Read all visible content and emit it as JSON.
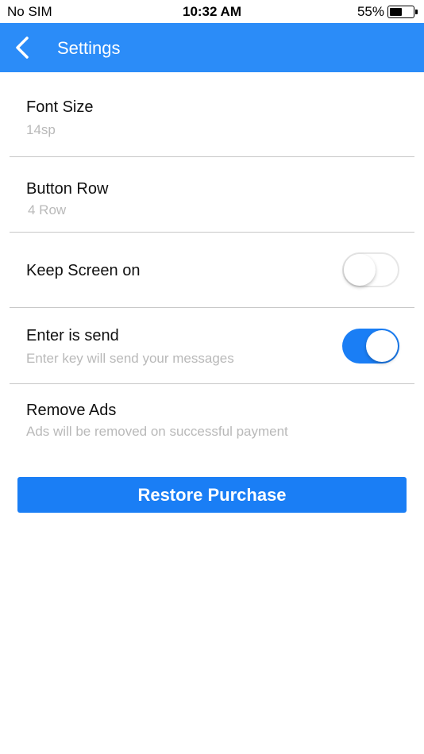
{
  "status_bar": {
    "carrier": "No SIM",
    "time": "10:32 AM",
    "battery_percent": "55%",
    "battery_level": 0.55
  },
  "app_bar": {
    "title": "Settings",
    "back_icon": "chevron-left-icon",
    "color": "#2b8cf8"
  },
  "settings": [
    {
      "label": "Font Size",
      "value": "14sp"
    },
    {
      "label": "Button Row",
      "value": "4 Row"
    },
    {
      "label": "Keep Screen on",
      "toggle": false
    },
    {
      "label": "Enter is send",
      "description": "Enter key will send your messages",
      "toggle": true
    },
    {
      "label": "Remove Ads",
      "description": "Ads will be removed on successful payment"
    }
  ],
  "restore_button": {
    "label": "Restore Purchase",
    "color": "#1a7ef5"
  }
}
